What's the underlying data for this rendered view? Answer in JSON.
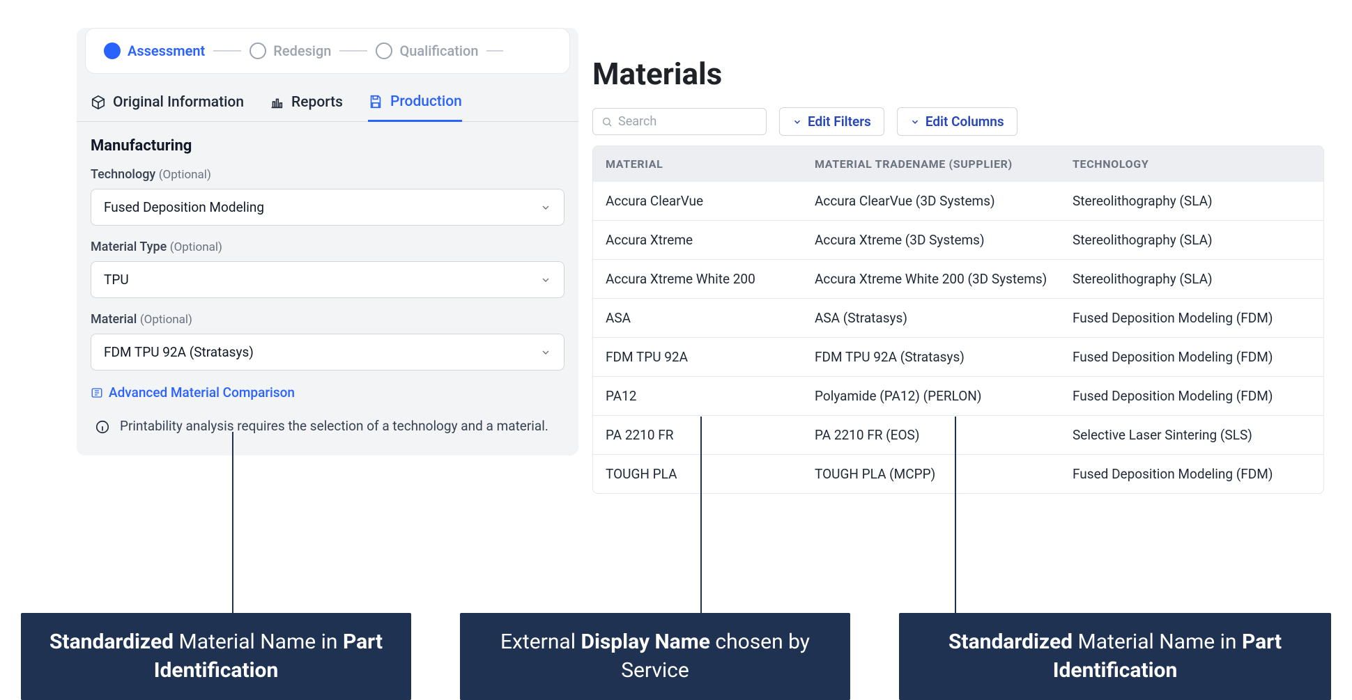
{
  "stepper": {
    "s1": "Assessment",
    "s2": "Redesign",
    "s3": "Qualification"
  },
  "tabs": {
    "original": "Original Information",
    "reports": "Reports",
    "production": "Production"
  },
  "manufacturing": {
    "title": "Manufacturing",
    "technology_label": "Technology",
    "optional": "(Optional)",
    "technology_value": "Fused Deposition Modeling",
    "material_type_label": "Material Type",
    "material_type_value": "TPU",
    "material_label": "Material",
    "material_value": "FDM TPU 92A (Stratasys)",
    "adv_link": "Advanced Material Comparison",
    "info": "Printability analysis requires the selection of a technology and a material."
  },
  "right": {
    "title": "Materials",
    "search_placeholder": "Search",
    "edit_filters": "Edit Filters",
    "edit_columns": "Edit Columns",
    "headers": {
      "material": "MATERIAL",
      "tradename": "MATERIAL TRADENAME (SUPPLIER)",
      "technology": "TECHNOLOGY"
    },
    "rows": [
      {
        "material": "Accura ClearVue",
        "tradename": "Accura ClearVue (3D Systems)",
        "technology": "Stereolithography (SLA)"
      },
      {
        "material": "Accura Xtreme",
        "tradename": "Accura Xtreme (3D Systems)",
        "technology": "Stereolithography (SLA)"
      },
      {
        "material": "Accura Xtreme White 200",
        "tradename": "Accura Xtreme White 200 (3D Systems)",
        "technology": "Stereolithography (SLA)"
      },
      {
        "material": "ASA",
        "tradename": "ASA (Stratasys)",
        "technology": "Fused Deposition Modeling (FDM)"
      },
      {
        "material": "FDM TPU 92A",
        "tradename": "FDM TPU 92A (Stratasys)",
        "technology": "Fused Deposition Modeling (FDM)"
      },
      {
        "material": "PA12",
        "tradename": "Polyamide (PA12) (PERLON)",
        "technology": "Fused Deposition Modeling (FDM)"
      },
      {
        "material": "PA 2210 FR",
        "tradename": "PA 2210 FR (EOS)",
        "technology": "Selective Laser Sintering (SLS)"
      },
      {
        "material": "TOUGH PLA",
        "tradename": "TOUGH PLA (MCPP)",
        "technology": "Fused Deposition Modeling (FDM)"
      }
    ]
  },
  "callouts": {
    "c1a": "Standardized",
    "c1b": " Material Name in ",
    "c1c": "Part Identification",
    "c2a": "External ",
    "c2b": "Display Name",
    "c2c": " chosen by Service",
    "c3a": "Standardized",
    "c3b": " Material Name in ",
    "c3c": "Part Identification"
  }
}
